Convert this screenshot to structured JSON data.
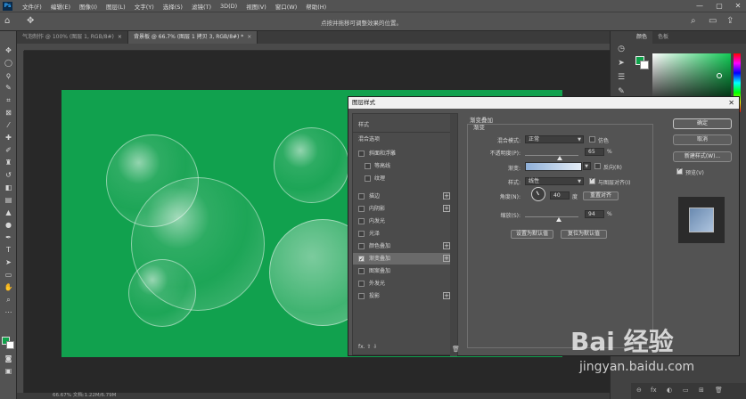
{
  "menu": {
    "logo": "Ps",
    "items": [
      "文件(F)",
      "编辑(E)",
      "图像(I)",
      "图层(L)",
      "文字(Y)",
      "选择(S)",
      "滤镜(T)",
      "3D(D)",
      "视图(V)",
      "窗口(W)",
      "帮助(H)"
    ],
    "minimize": "—",
    "maximize": "▢",
    "close": "✕"
  },
  "options": {
    "hint": "点按并拖移可调整效果的位置。",
    "home_icon": "home-icon",
    "move_icon": "move-icon",
    "search_icon": "search-icon",
    "workspace_icon": "workspace-icon",
    "share_icon": "share-icon"
  },
  "tabs": [
    {
      "label": "气泡制作 @ 100% (图层 1, RGB/8#)",
      "close": "×",
      "active": false
    },
    {
      "label": "背景板 @ 66.7% (图层 1 拷贝 3, RGB/8#) *",
      "close": "×",
      "active": true
    }
  ],
  "status": {
    "text": "66.67%     文档:1.22M/6.79M"
  },
  "panel": {
    "tabs": [
      "颜色",
      "色板"
    ]
  },
  "dialog": {
    "title": "图层样式",
    "close": "✕",
    "styles_header": "样式",
    "blend_options": "混合选项",
    "items": [
      {
        "label": "斜面和浮雕",
        "checked": false,
        "plus": false,
        "sub": false
      },
      {
        "label": "等高线",
        "checked": false,
        "plus": false,
        "sub": true
      },
      {
        "label": "纹理",
        "checked": false,
        "plus": false,
        "sub": true
      },
      {
        "label": "描边",
        "checked": false,
        "plus": true,
        "sub": false
      },
      {
        "label": "内阴影",
        "checked": false,
        "plus": true,
        "sub": false
      },
      {
        "label": "内发光",
        "checked": false,
        "plus": false,
        "sub": false
      },
      {
        "label": "光泽",
        "checked": false,
        "plus": false,
        "sub": false
      },
      {
        "label": "颜色叠加",
        "checked": false,
        "plus": true,
        "sub": false
      },
      {
        "label": "渐变叠加",
        "checked": true,
        "plus": true,
        "sub": false,
        "active": true
      },
      {
        "label": "图案叠加",
        "checked": false,
        "plus": false,
        "sub": false
      },
      {
        "label": "外发光",
        "checked": false,
        "plus": false,
        "sub": false
      },
      {
        "label": "投影",
        "checked": false,
        "plus": true,
        "sub": false
      }
    ],
    "footer_fx": "fx.  ⇧  ⇩",
    "section_title": "渐变叠加",
    "group_title": "渐变",
    "blend_mode_label": "混合模式:",
    "blend_mode_value": "正常",
    "dither_label": "仿色",
    "opacity_label": "不透明度(P):",
    "opacity_value": "65",
    "opacity_pct": 0.65,
    "opacity_unit": "%",
    "gradient_label": "渐变:",
    "reverse_label": "反向(R)",
    "style_label": "样式:",
    "style_value": "线性",
    "align_label": "与图层对齐(I)",
    "angle_label": "角度(N):",
    "angle_value": "40",
    "angle_unit": "度",
    "reset_align": "重置对齐",
    "scale_label": "缩放(S):",
    "scale_value": "94",
    "scale_pct": 0.64,
    "scale_unit": "%",
    "set_default": "设置为默认值",
    "reset_default": "复位为默认值",
    "ok": "确定",
    "cancel": "取消",
    "new_style": "新建样式(W)...",
    "preview_label": "预览(V)"
  },
  "watermark": {
    "logo": "Bai 经验",
    "url": "jingyan.baidu.com"
  },
  "colors": {
    "canvas": "#11a14e",
    "foreground": "#0fa14a"
  }
}
